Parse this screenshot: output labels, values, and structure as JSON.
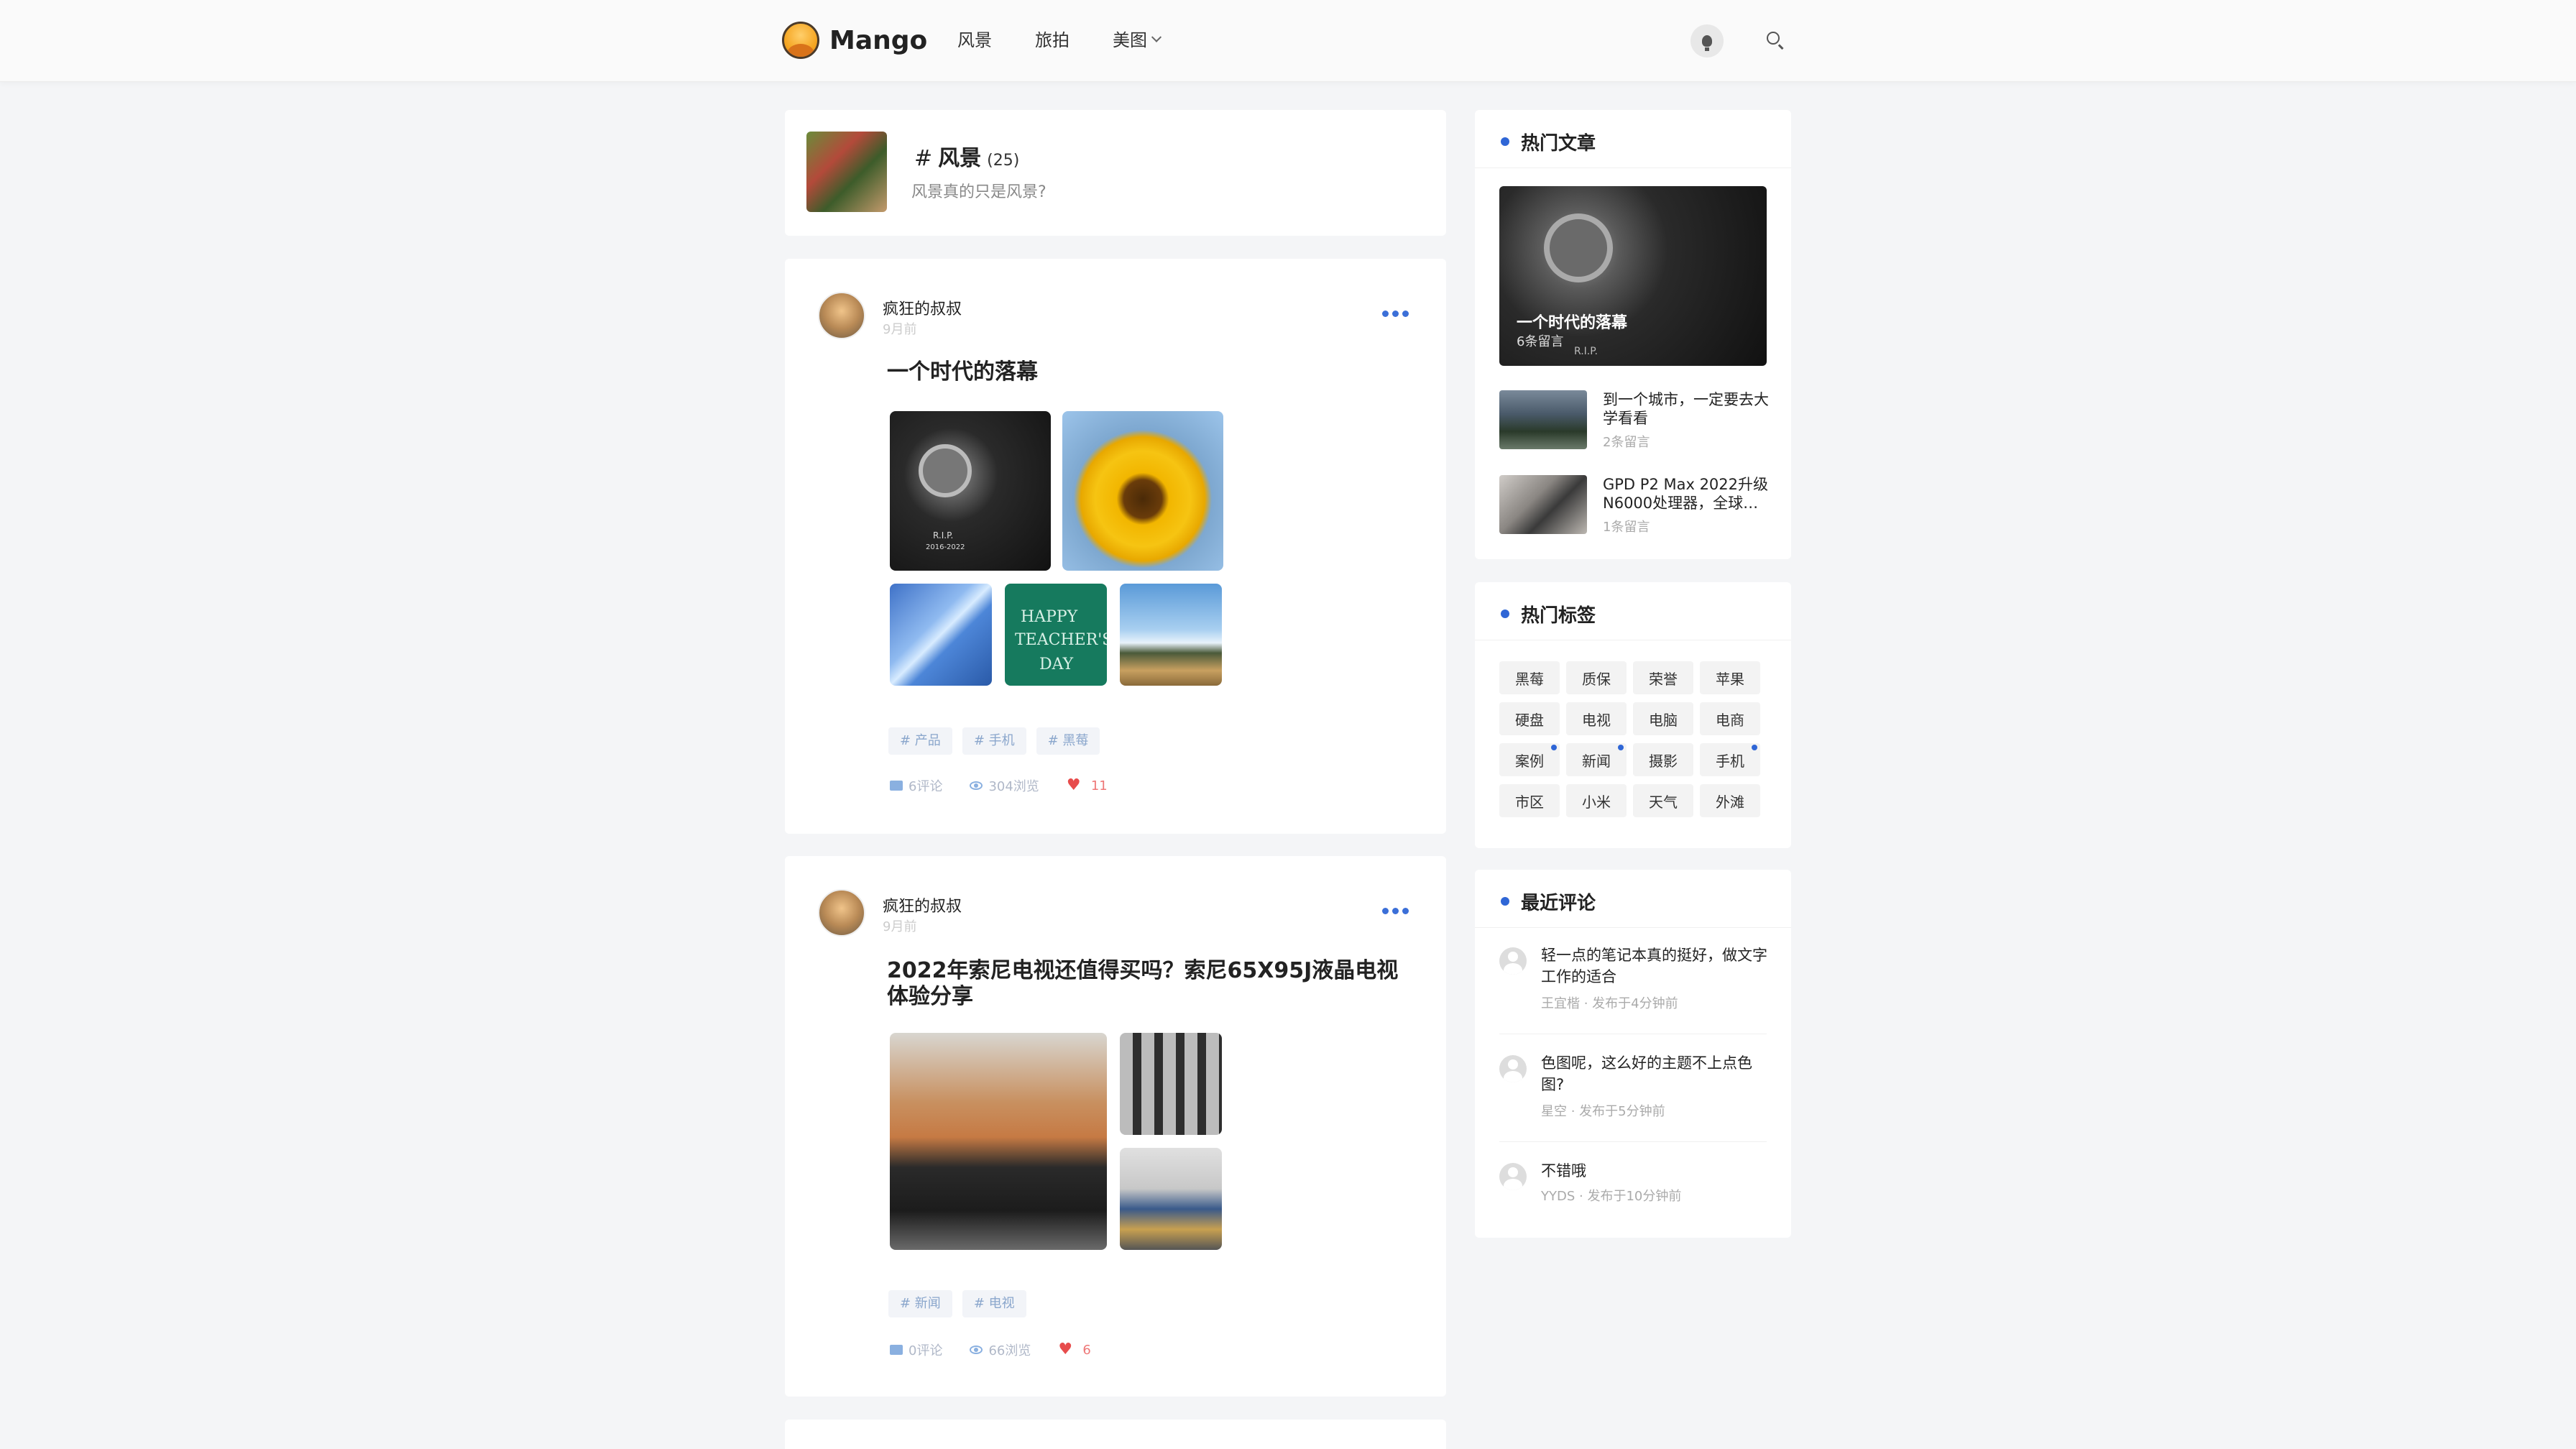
{
  "header": {
    "logo_text": "Mango",
    "nav": [
      {
        "label": "风景"
      },
      {
        "label": "旅拍"
      },
      {
        "label": "美图"
      }
    ]
  },
  "category": {
    "hash": "#",
    "name": "风景",
    "count": "(25)",
    "description": "风景真的只是风景?"
  },
  "posts": [
    {
      "author": "疯狂的叔叔",
      "time": "9月前",
      "title": "一个时代的落幕",
      "tags": [
        "# 产品",
        "# 手机",
        "# 黑莓"
      ],
      "comments": "6评论",
      "views": "304浏览",
      "likes": "11"
    },
    {
      "author": "疯狂的叔叔",
      "time": "9月前",
      "title": "2022年索尼电视还值得买吗？索尼65X95J液晶电视体验分享",
      "tags": [
        "# 新闻",
        "# 电视"
      ],
      "comments": "0评论",
      "views": "66浏览",
      "likes": "6"
    }
  ],
  "image_text": {
    "blackberry_rip": "R.I.P.",
    "blackberry_years": "2016-2022",
    "teachers_day_line1": "HAPPY",
    "teachers_day_line2": "TEACHER'S",
    "teachers_day_line3": "DAY"
  },
  "sidebar": {
    "hot_articles": {
      "heading": "热门文章",
      "hero": {
        "title": "一个时代的落幕",
        "sub": "6条留言",
        "rip": "R.I.P."
      },
      "items": [
        {
          "title": "到一个城市，一定要去大学看看",
          "sub": "2条留言"
        },
        {
          "title": "GPD P2 Max 2022升级N6000处理器，全球…",
          "sub": "1条留言"
        }
      ]
    },
    "hot_tags": {
      "heading": "热门标签",
      "tags": [
        {
          "label": "黑莓",
          "dot": false
        },
        {
          "label": "质保",
          "dot": false
        },
        {
          "label": "荣誉",
          "dot": false
        },
        {
          "label": "苹果",
          "dot": false
        },
        {
          "label": "硬盘",
          "dot": false
        },
        {
          "label": "电视",
          "dot": false
        },
        {
          "label": "电脑",
          "dot": false
        },
        {
          "label": "电商",
          "dot": false
        },
        {
          "label": "案例",
          "dot": true
        },
        {
          "label": "新闻",
          "dot": true
        },
        {
          "label": "摄影",
          "dot": false
        },
        {
          "label": "手机",
          "dot": true
        },
        {
          "label": "市区",
          "dot": false
        },
        {
          "label": "小米",
          "dot": false
        },
        {
          "label": "天气",
          "dot": false
        },
        {
          "label": "外滩",
          "dot": false
        }
      ]
    },
    "recent_comments": {
      "heading": "最近评论",
      "items": [
        {
          "text": "轻一点的笔记本真的挺好，做文字工作的适合",
          "meta": "王宜楷 · 发布于4分钟前"
        },
        {
          "text": "色图呢，这么好的主题不上点色图?",
          "meta": "星空 · 发布于5分钟前"
        },
        {
          "text": "不错哦",
          "meta": "YYDS · 发布于10分钟前"
        }
      ]
    }
  },
  "colors": {
    "accent": "#2f66d6",
    "like": "#e74c4c",
    "tag_text": "#8aa6cc"
  }
}
